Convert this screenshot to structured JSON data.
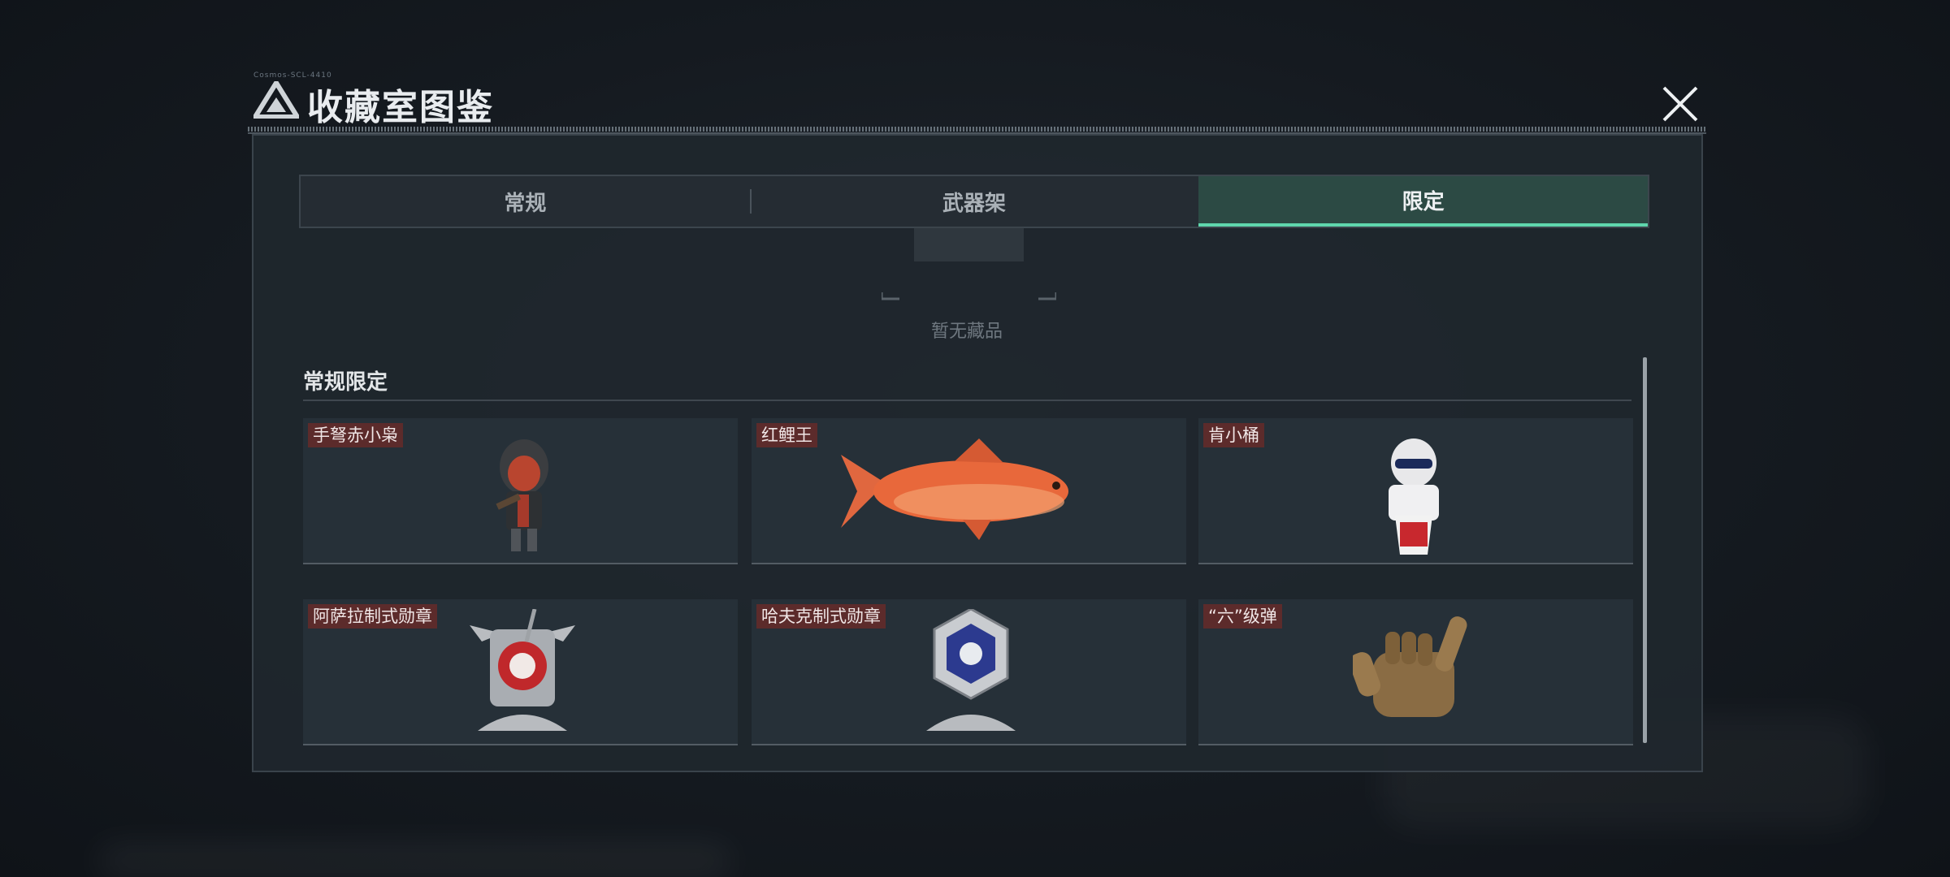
{
  "window": {
    "title": "收藏室图鉴",
    "small_text": "Cosmos-SCL-4410"
  },
  "tabs": [
    {
      "label": "常规",
      "active": false
    },
    {
      "label": "武器架",
      "active": false
    },
    {
      "label": "限定",
      "active": true
    }
  ],
  "empty_state": {
    "text": "暂无藏品"
  },
  "section": {
    "title": "常规限定"
  },
  "items": [
    {
      "label": "手弩赤小枭",
      "icon": "hooded-figure-icon"
    },
    {
      "label": "红鲤王",
      "icon": "red-carp-icon"
    },
    {
      "label": "肯小桶",
      "icon": "bucket-mascot-icon"
    },
    {
      "label": "阿萨拉制式勋章",
      "icon": "red-medal-icon"
    },
    {
      "label": "哈夫克制式勋章",
      "icon": "blue-medal-icon"
    },
    {
      "label": "“六”级弹",
      "icon": "bronze-hand-icon"
    }
  ],
  "colors": {
    "accent": "#5fd6ad",
    "label_bg": "#5c2b2b",
    "panel_bg": "#20272e"
  }
}
